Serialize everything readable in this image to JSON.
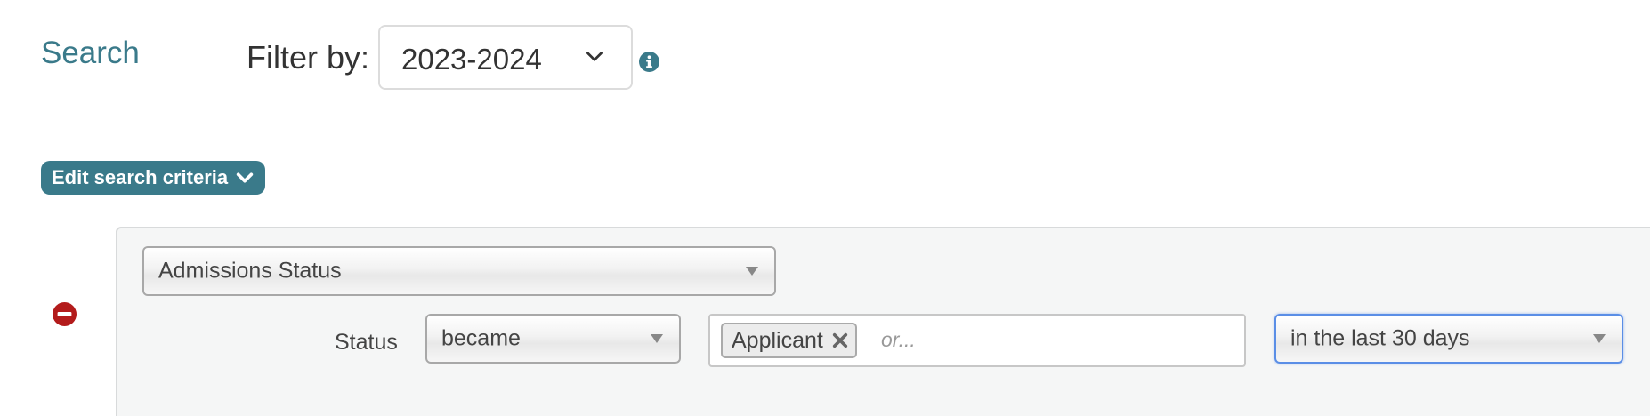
{
  "header": {
    "search_link": "Search",
    "filter_label": "Filter by:",
    "year_selected": "2023-2024"
  },
  "criteria": {
    "edit_button_label": "Edit search criteria",
    "field_selected": "Admissions Status",
    "status_label": "Status",
    "operator_selected": "became",
    "tags": [
      "Applicant"
    ],
    "tags_placeholder": "or...",
    "range_selected": "in the last 30 days"
  },
  "icons": {
    "info": "info-icon",
    "remove": "remove-criterion-icon",
    "chevron": "chevron-down-icon",
    "tag_remove": "close-icon"
  },
  "colors": {
    "accent": "#3a7a8a",
    "remove_red": "#b31b1b",
    "focus_blue": "#5a8ee6"
  }
}
